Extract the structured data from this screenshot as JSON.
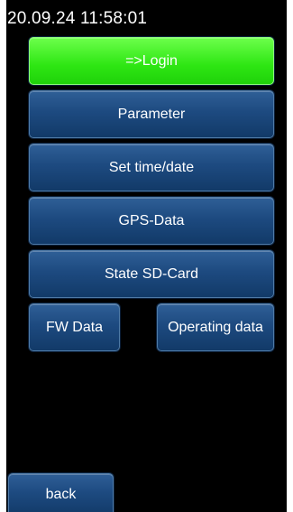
{
  "header": {
    "datetime": "20.09.24  11:58:01"
  },
  "menu": {
    "login": "=>Login",
    "parameter": "Parameter",
    "set_time": "Set time/date",
    "gps": "GPS-Data",
    "sd": "State SD-Card",
    "fw": "FW Data",
    "operating": "Operating data"
  },
  "footer": {
    "back": "back"
  },
  "colors": {
    "accent_green": "#2ee613",
    "button_blue": "#1d4a80",
    "background": "#000000"
  }
}
